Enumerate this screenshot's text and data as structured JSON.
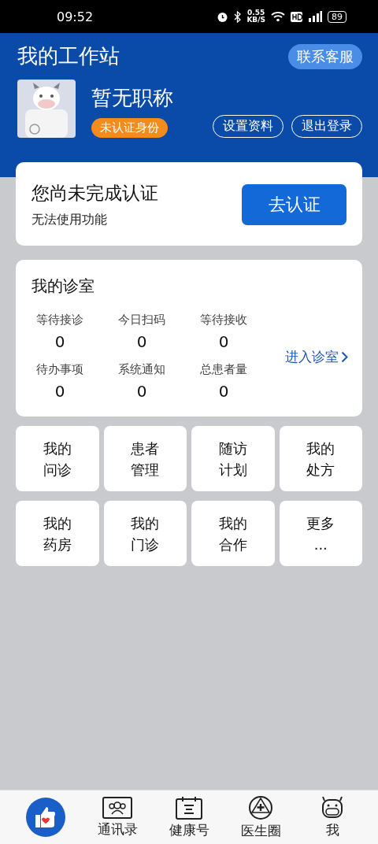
{
  "status_bar": {
    "time": "09:52",
    "speed": "0.55",
    "speed_unit": "KB/S",
    "battery": "89"
  },
  "header": {
    "title": "我的工作站",
    "service_button": "联系客服",
    "name": "暂无职称",
    "badge": "未认证身份",
    "buttons": [
      "设置资料",
      "退出登录"
    ]
  },
  "verify_card": {
    "title": "您尚未完成认证",
    "subtitle": "无法使用功能",
    "button": "去认证"
  },
  "clinic": {
    "title": "我的诊室",
    "enter_link": "进入诊室",
    "stats": [
      {
        "label": "等待接诊",
        "value": "0"
      },
      {
        "label": "今日扫码",
        "value": "0"
      },
      {
        "label": "等待接收",
        "value": "0"
      },
      {
        "label": "待办事项",
        "value": "0"
      },
      {
        "label": "系统通知",
        "value": "0"
      },
      {
        "label": "总患者量",
        "value": "0"
      }
    ]
  },
  "tiles": [
    {
      "line1": "我的",
      "line2": "问诊"
    },
    {
      "line1": "患者",
      "line2": "管理"
    },
    {
      "line1": "随访",
      "line2": "计划"
    },
    {
      "line1": "我的",
      "line2": "处方"
    },
    {
      "line1": "我的",
      "line2": "药房"
    },
    {
      "line1": "我的",
      "line2": "门诊"
    },
    {
      "line1": "我的",
      "line2": "合作"
    },
    {
      "line1": "更多",
      "line2": "..."
    }
  ],
  "bottom_nav": [
    {
      "kind": "home",
      "selected": true
    },
    {
      "kind": "contacts",
      "label": "通讯录",
      "selected": false
    },
    {
      "kind": "health",
      "label": "健康号",
      "selected": false
    },
    {
      "kind": "circle",
      "label": "医生圈",
      "selected": false
    },
    {
      "kind": "me",
      "label": "我",
      "selected": false
    }
  ]
}
